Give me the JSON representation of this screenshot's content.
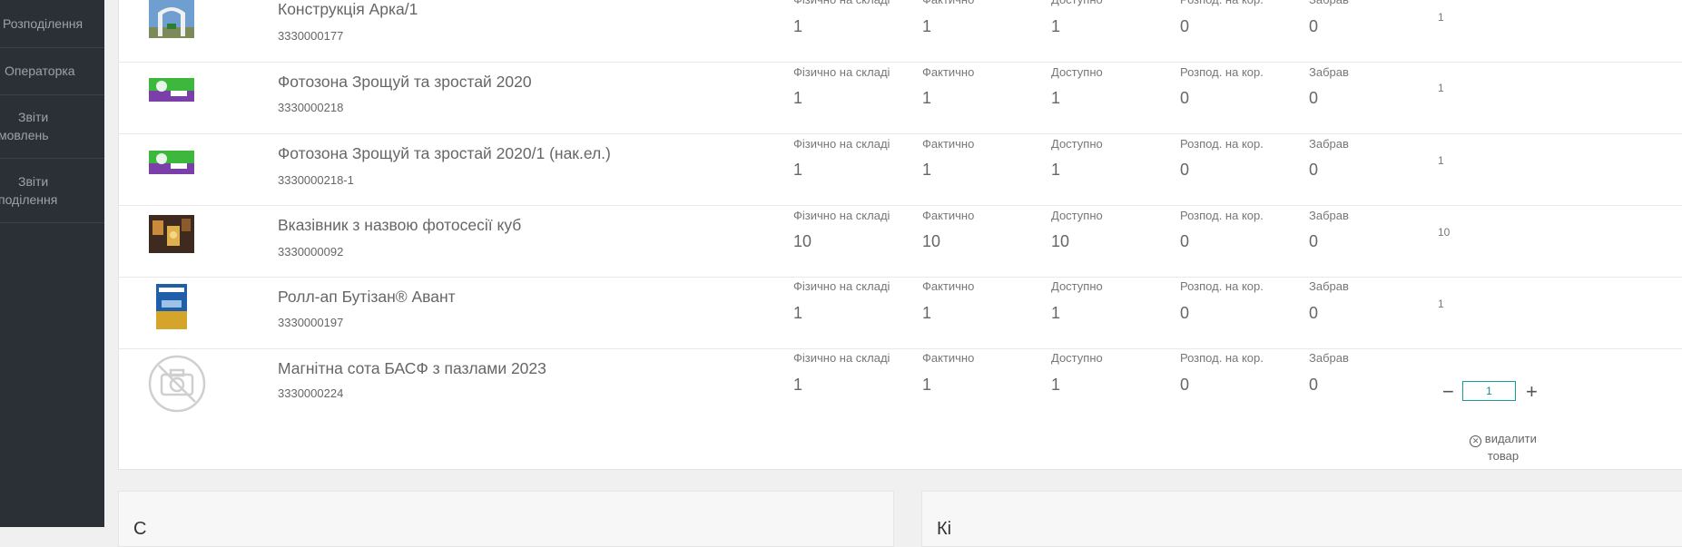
{
  "sidebar": {
    "items": [
      {
        "label": "Розподілення"
      },
      {
        "label": "Операторка"
      },
      {
        "label_line1": "Звіти",
        "label_line2": "мовлень"
      },
      {
        "label_line1": "Звіти",
        "label_line2": "поділення"
      }
    ]
  },
  "stock_labels": {
    "physical": "Фізично на складі",
    "actual": "Фактично",
    "available": "Доступно",
    "distributed": "Розпод. на кор.",
    "taken": "Забрав"
  },
  "products": [
    {
      "name": "Конструкція Арка/1",
      "sku": "3330000177",
      "physical": "1",
      "actual": "1",
      "available": "1",
      "distributed": "0",
      "taken": "0",
      "qty": "1"
    },
    {
      "name": "Фотозона Зрощуй та зростай 2020",
      "sku": "3330000218",
      "physical": "1",
      "actual": "1",
      "available": "1",
      "distributed": "0",
      "taken": "0",
      "qty": "1"
    },
    {
      "name": "Фотозона Зрощуй та зростай 2020/1 (нак.ел.)",
      "sku": "3330000218-1",
      "physical": "1",
      "actual": "1",
      "available": "1",
      "distributed": "0",
      "taken": "0",
      "qty": "1"
    },
    {
      "name": "Вказівник з назвою фотосесії куб",
      "sku": "3330000092",
      "physical": "10",
      "actual": "10",
      "available": "10",
      "distributed": "0",
      "taken": "0",
      "qty": "10"
    },
    {
      "name": "Ролл-ап Бутізан® Авант",
      "sku": "3330000197",
      "physical": "1",
      "actual": "1",
      "available": "1",
      "distributed": "0",
      "taken": "0",
      "qty": "1"
    },
    {
      "name": "Магнітна сота БАСФ з пазлами 2023",
      "sku": "3330000224",
      "physical": "1",
      "actual": "1",
      "available": "1",
      "distributed": "0",
      "taken": "0"
    }
  ],
  "editor": {
    "qty_value": "1",
    "minus": "−",
    "plus": "+",
    "remove_label_line1": "видалити",
    "remove_label_line2": "товар"
  },
  "bottom_panels": {
    "left_title": "С",
    "right_title": "Кі"
  },
  "colors": {
    "sidebar_bg": "#2b3036",
    "accent": "#1a9b9b"
  }
}
